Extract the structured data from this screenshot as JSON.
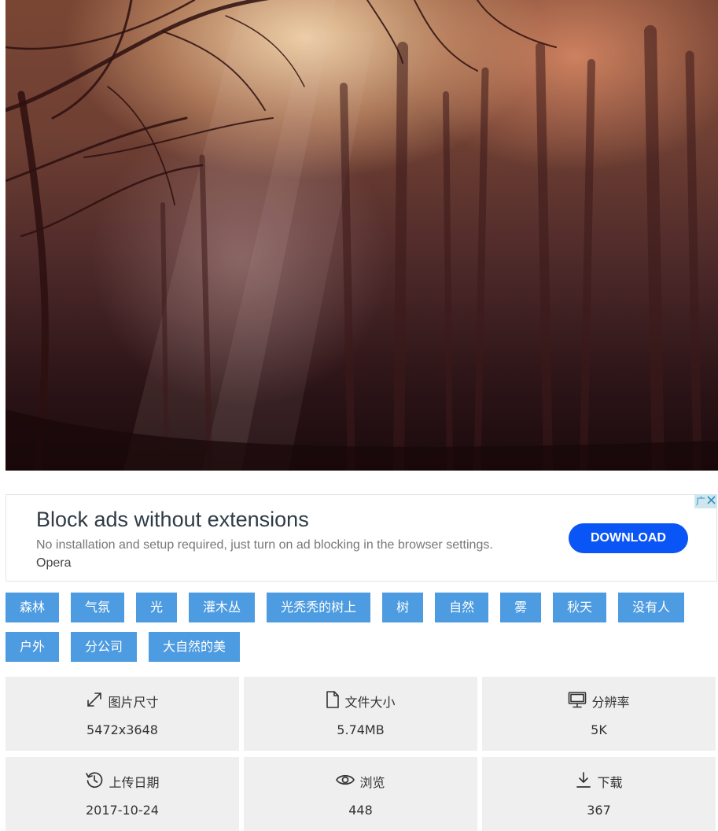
{
  "ad": {
    "title": "Block ads without extensions",
    "text": "No installation and setup required, just turn on ad blocking in the browser settings.",
    "brand": "Opera",
    "button_label": "DOWNLOAD",
    "badge_label": "广"
  },
  "tags": [
    "森林",
    "气氛",
    "光",
    "灌木丛",
    "光秃秃的树上",
    "树",
    "自然",
    "雾",
    "秋天",
    "没有人",
    "户外",
    "分公司",
    "大自然的美"
  ],
  "stats": [
    {
      "icon": "resize-icon",
      "label": "图片尺寸",
      "value": "5472x3648"
    },
    {
      "icon": "file-icon",
      "label": "文件大小",
      "value": "5.74MB"
    },
    {
      "icon": "monitor-icon",
      "label": "分辨率",
      "value": "5K"
    },
    {
      "icon": "history-icon",
      "label": "上传日期",
      "value": "2017-10-24"
    },
    {
      "icon": "eye-icon",
      "label": "浏览",
      "value": "448"
    },
    {
      "icon": "download-icon",
      "label": "下载",
      "value": "367"
    }
  ]
}
